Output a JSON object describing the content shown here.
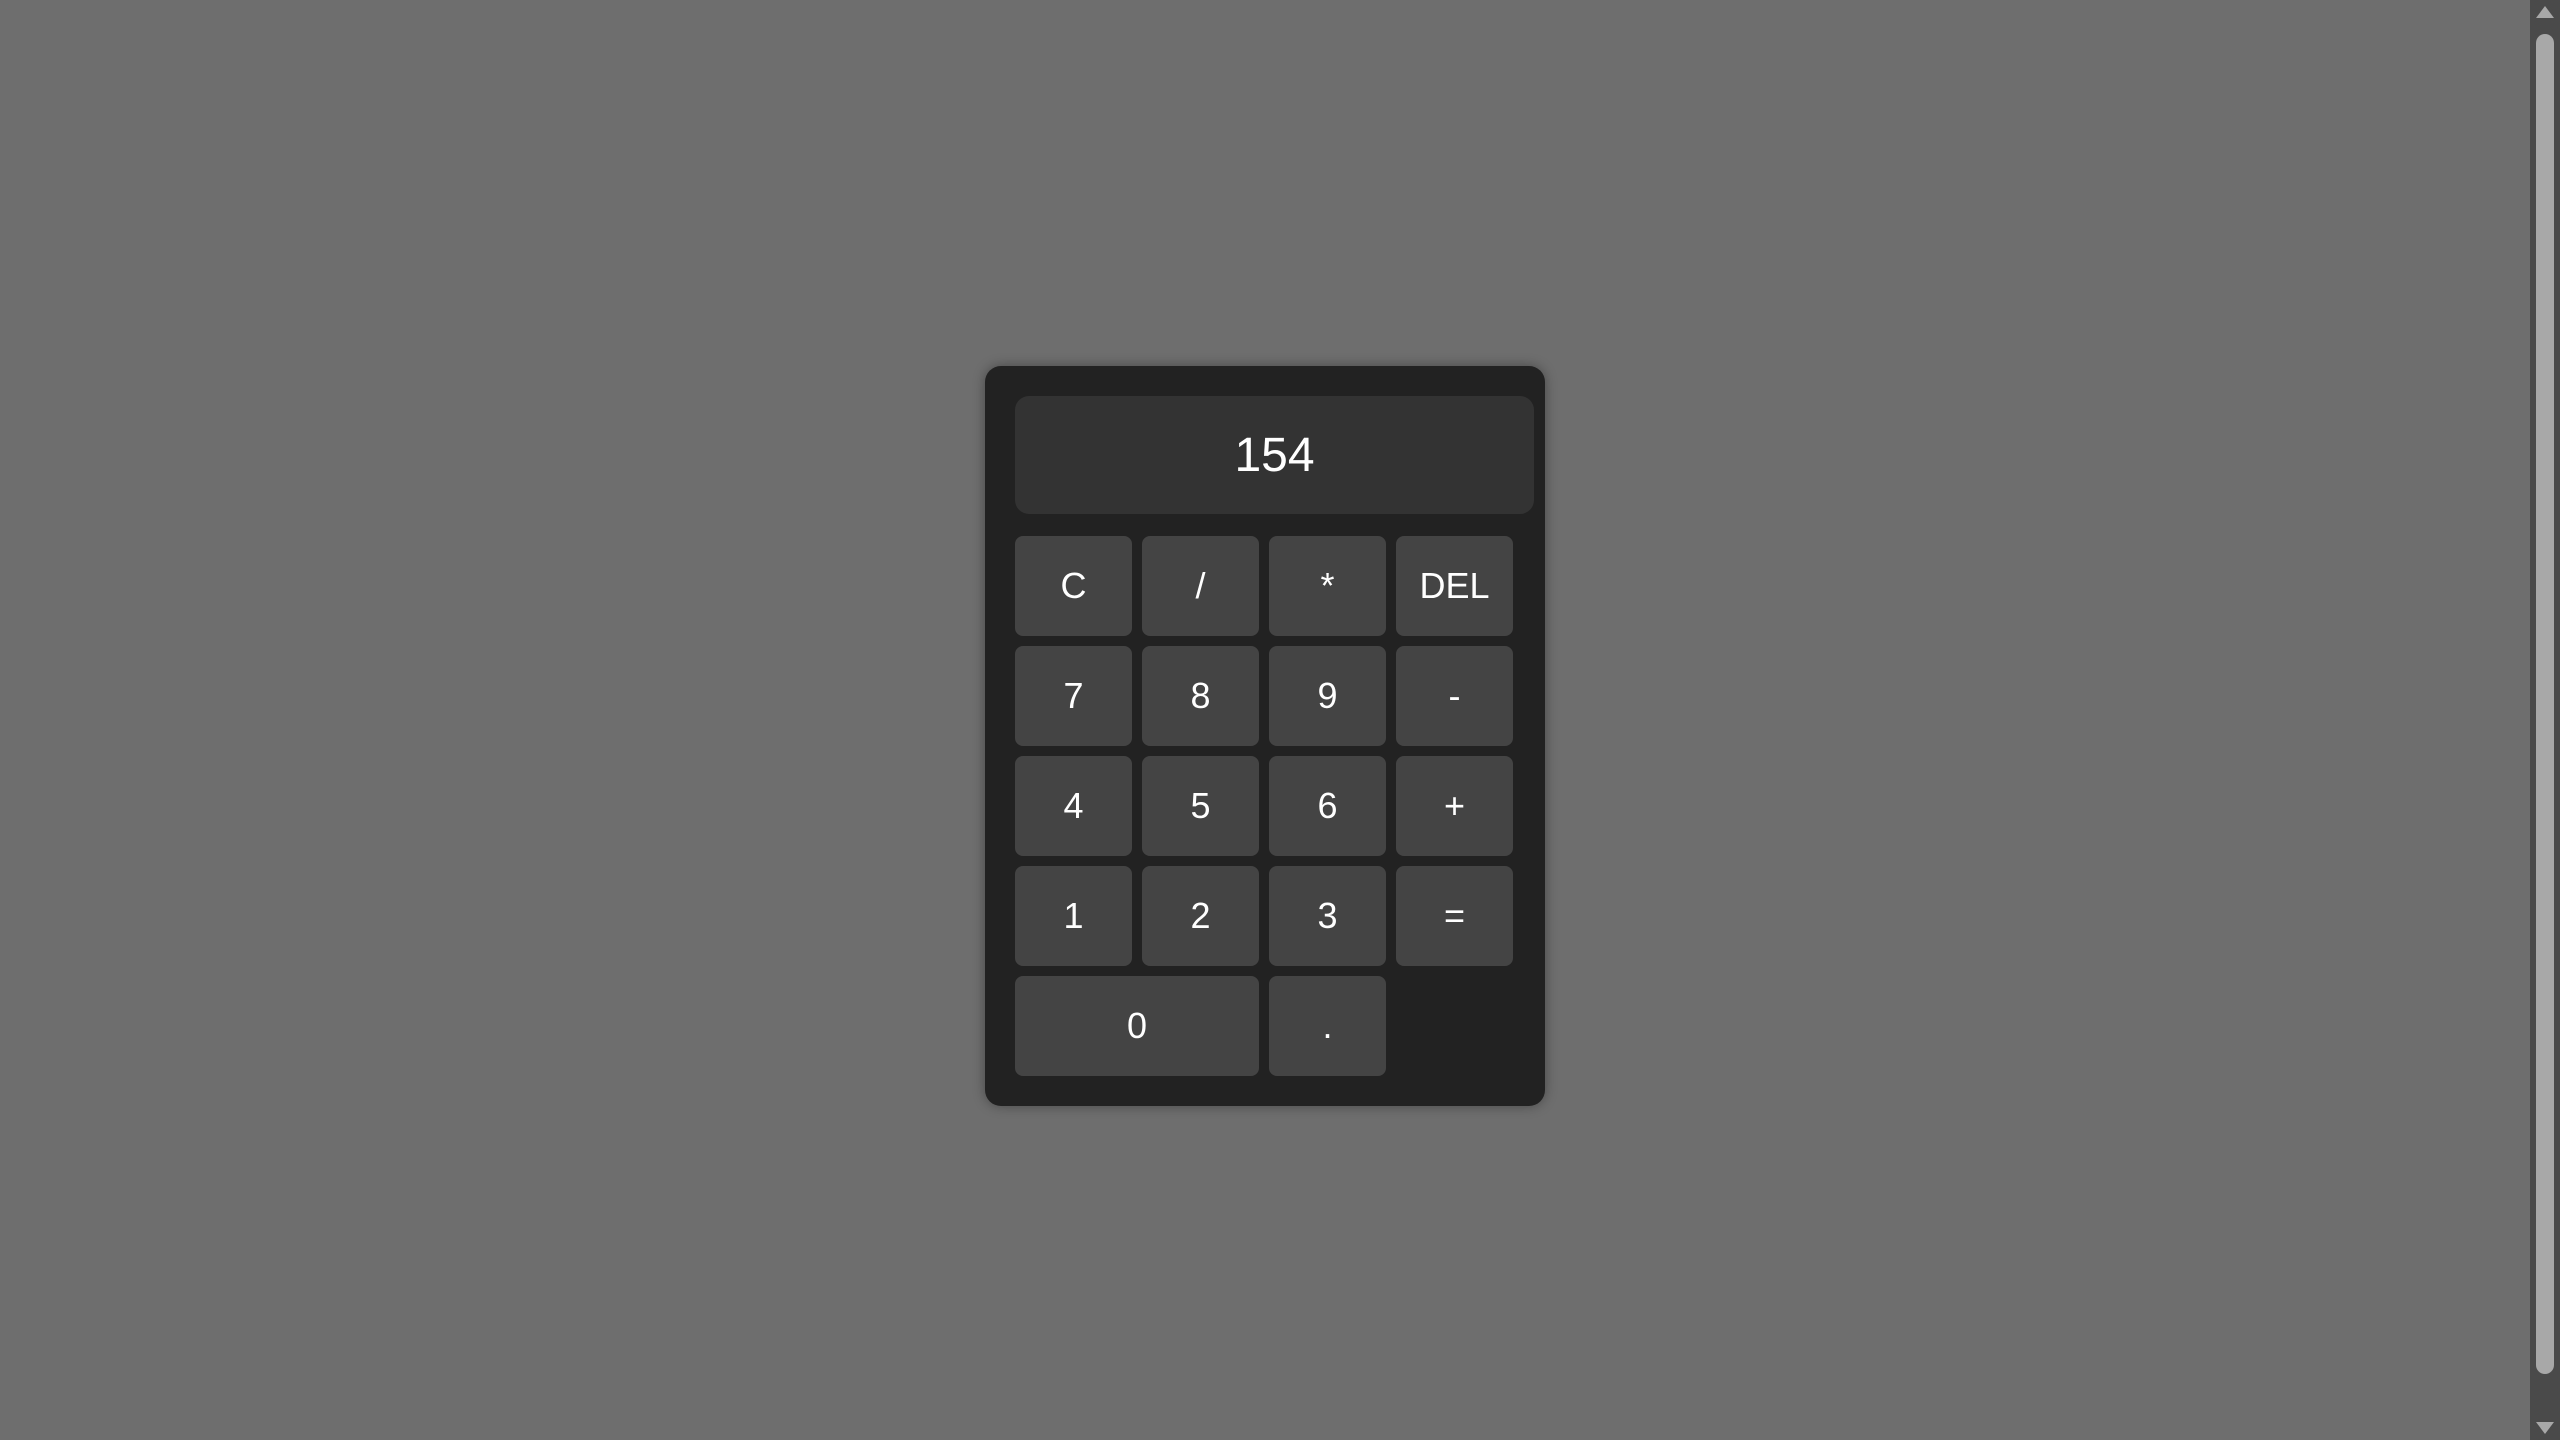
{
  "display": {
    "value": "154"
  },
  "keys": [
    {
      "label": "C",
      "name": "clear-button"
    },
    {
      "label": "/",
      "name": "divide-button"
    },
    {
      "label": "*",
      "name": "multiply-button"
    },
    {
      "label": "DEL",
      "name": "delete-button"
    },
    {
      "label": "7",
      "name": "digit-7-button"
    },
    {
      "label": "8",
      "name": "digit-8-button"
    },
    {
      "label": "9",
      "name": "digit-9-button"
    },
    {
      "label": "-",
      "name": "subtract-button"
    },
    {
      "label": "4",
      "name": "digit-4-button"
    },
    {
      "label": "5",
      "name": "digit-5-button"
    },
    {
      "label": "6",
      "name": "digit-6-button"
    },
    {
      "label": "+",
      "name": "add-button"
    },
    {
      "label": "1",
      "name": "digit-1-button"
    },
    {
      "label": "2",
      "name": "digit-2-button"
    },
    {
      "label": "3",
      "name": "digit-3-button"
    },
    {
      "label": "=",
      "name": "equals-button"
    },
    {
      "label": "0",
      "name": "digit-0-button"
    },
    {
      "label": ".",
      "name": "decimal-button"
    }
  ],
  "colors": {
    "page_background": "#6e6e6e",
    "calculator_body": "#222222",
    "display_background": "#333333",
    "key_background": "#444444",
    "text": "#ffffff"
  },
  "icons": {
    "scroll_up": "triangle-up-icon",
    "scroll_down": "triangle-down-icon"
  }
}
